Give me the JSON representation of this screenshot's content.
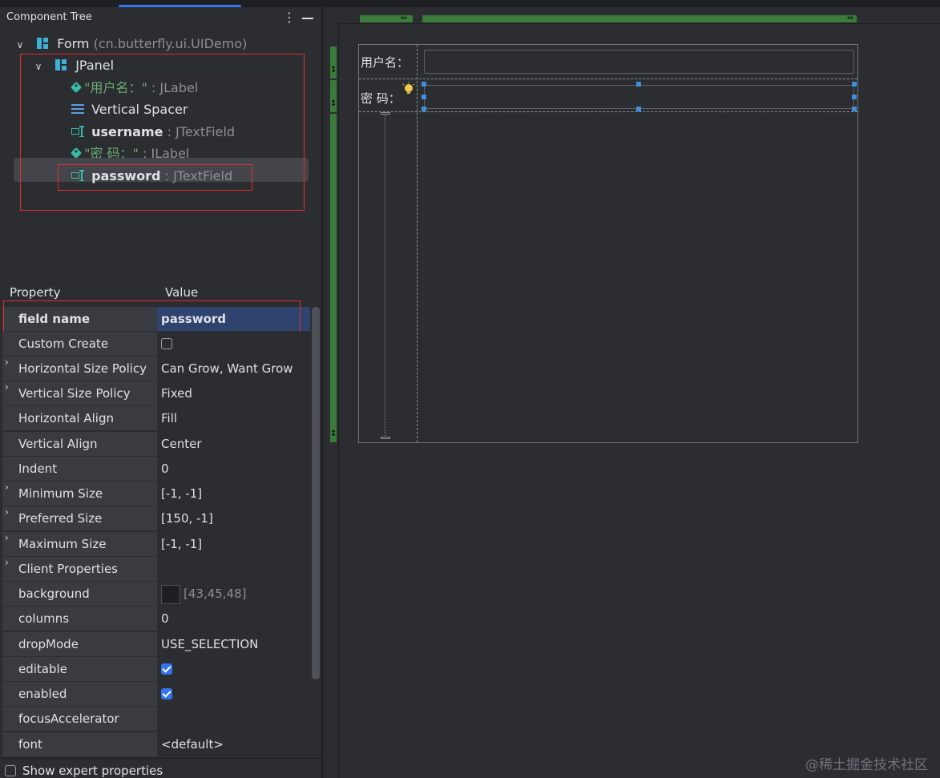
{
  "component_tree": {
    "title": "Component Tree",
    "more_icon": "⋮",
    "form": {
      "name": "Form",
      "class": "(cn.butterfly.ui.UIDemo)"
    },
    "jpanel": {
      "name": "JPanel"
    },
    "items": [
      {
        "name": "\"用户名：\"",
        "type": ": JLabel"
      },
      {
        "name": "Vertical Spacer"
      },
      {
        "name": "username",
        "type": ": JTextField"
      },
      {
        "name": "\"密  码：\"",
        "type": ": JLabel"
      },
      {
        "name": "password",
        "type": ": JTextField"
      }
    ]
  },
  "properties": {
    "header_property": "Property",
    "header_value": "Value",
    "rows": [
      {
        "name": "field name",
        "value": "password"
      },
      {
        "name": "Custom Create",
        "value": ""
      },
      {
        "name": "Horizontal Size Policy",
        "value": "Can Grow, Want Grow"
      },
      {
        "name": "Vertical Size Policy",
        "value": "Fixed"
      },
      {
        "name": "Horizontal Align",
        "value": "Fill"
      },
      {
        "name": "Vertical Align",
        "value": "Center"
      },
      {
        "name": "Indent",
        "value": "0"
      },
      {
        "name": "Minimum Size",
        "value": "[-1, -1]"
      },
      {
        "name": "Preferred Size",
        "value": "[150, -1]"
      },
      {
        "name": "Maximum Size",
        "value": "[-1, -1]"
      },
      {
        "name": "Client Properties",
        "value": ""
      },
      {
        "name": "background",
        "value": "[43,45,48]"
      },
      {
        "name": "columns",
        "value": "0"
      },
      {
        "name": "dropMode",
        "value": "USE_SELECTION"
      },
      {
        "name": "editable",
        "value": ""
      },
      {
        "name": "enabled",
        "value": ""
      },
      {
        "name": "focusAccelerator",
        "value": ""
      },
      {
        "name": "font",
        "value": "<default>"
      }
    ],
    "show_expert": "Show expert properties"
  },
  "designer": {
    "label_username": "用户名：",
    "label_password": "密  码："
  },
  "watermark": "@稀土掘金技术社区",
  "colors": {
    "selection_blue": "#2e436e",
    "accent": "#3574f0",
    "ruler_green": "#3a7a3a",
    "highlight_red": "#e03030"
  }
}
